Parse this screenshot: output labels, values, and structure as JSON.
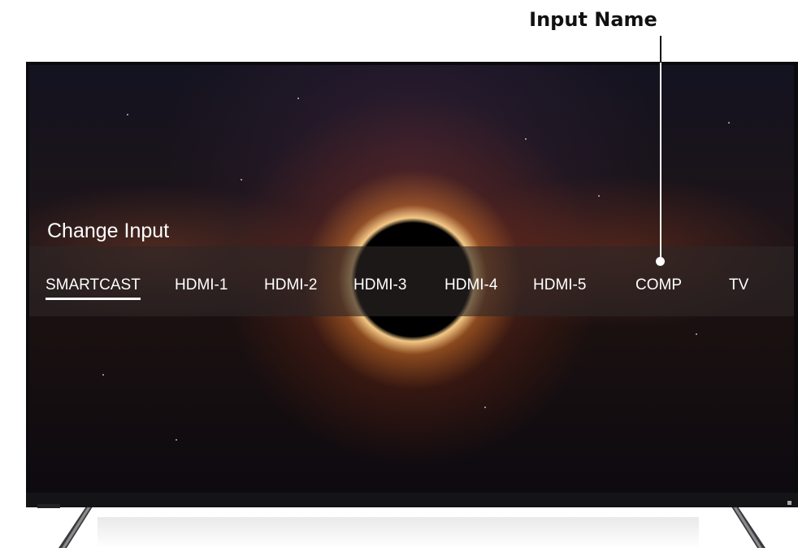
{
  "callout": {
    "label": "Input Name"
  },
  "screen": {
    "title": "Change Input",
    "inputs": [
      {
        "label": "SMARTCAST",
        "selected": true
      },
      {
        "label": "HDMI-1",
        "selected": false
      },
      {
        "label": "HDMI-2",
        "selected": false
      },
      {
        "label": "HDMI-3",
        "selected": false
      },
      {
        "label": "HDMI-4",
        "selected": false
      },
      {
        "label": "HDMI-5",
        "selected": false
      },
      {
        "label": "COMP",
        "selected": false
      },
      {
        "label": "TV",
        "selected": false
      }
    ]
  },
  "colors": {
    "text": "#ffffff",
    "bar": "#2d2626",
    "callout_text": "#111111"
  }
}
